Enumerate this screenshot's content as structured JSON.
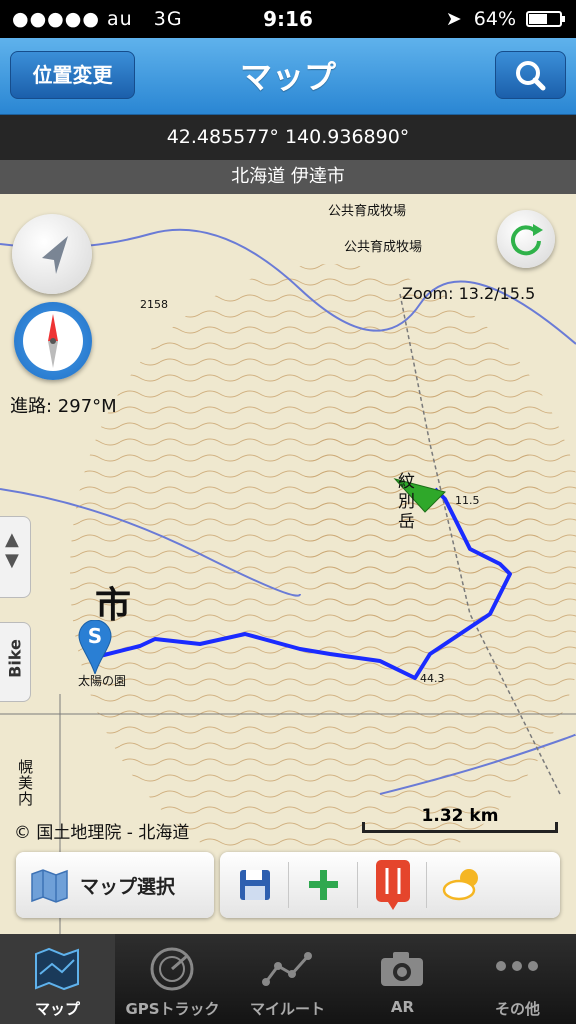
{
  "status": {
    "carrier": "au",
    "network": "3G",
    "time": "9:16",
    "battery": "64%",
    "battery_level": 0.64
  },
  "nav": {
    "title": "マップ",
    "location_button": "位置変更",
    "search_icon": "search-icon"
  },
  "coordinates": "42.485577° 140.936890°",
  "place": "北海道 伊達市",
  "map": {
    "zoom": "Zoom: 13.2/15.5",
    "heading": "進路: 297°M",
    "attribution": "© 国土地理院 - 北海道",
    "scale": "1.32 km",
    "side_mode": "Bike",
    "start_marker": "S",
    "labels": {
      "city": "市",
      "farm1": "公共育成牧場",
      "farm2": "公共育成牧場",
      "peak": "紋別岳",
      "school": "太陽の園",
      "sapporo": "幌美内",
      "elev1": "2158",
      "elev2": "11.5",
      "elev3": "44.3"
    }
  },
  "toolbar": {
    "map_select": "マップ選択",
    "icons": [
      "save-icon",
      "add-icon",
      "restaurant-icon",
      "weather-icon"
    ]
  },
  "tabs": [
    {
      "label": "マップ",
      "icon": "map-icon",
      "active": true
    },
    {
      "label": "GPSトラック",
      "icon": "radar-icon",
      "active": false
    },
    {
      "label": "マイルート",
      "icon": "route-icon",
      "active": false
    },
    {
      "label": "AR",
      "icon": "camera-icon",
      "active": false
    },
    {
      "label": "その他",
      "icon": "more-icon",
      "active": false
    }
  ],
  "colors": {
    "nav": "#2a86d3",
    "route": "#1a2bff",
    "marker": "#2a7fd4",
    "arrow": "#2fa82a"
  }
}
